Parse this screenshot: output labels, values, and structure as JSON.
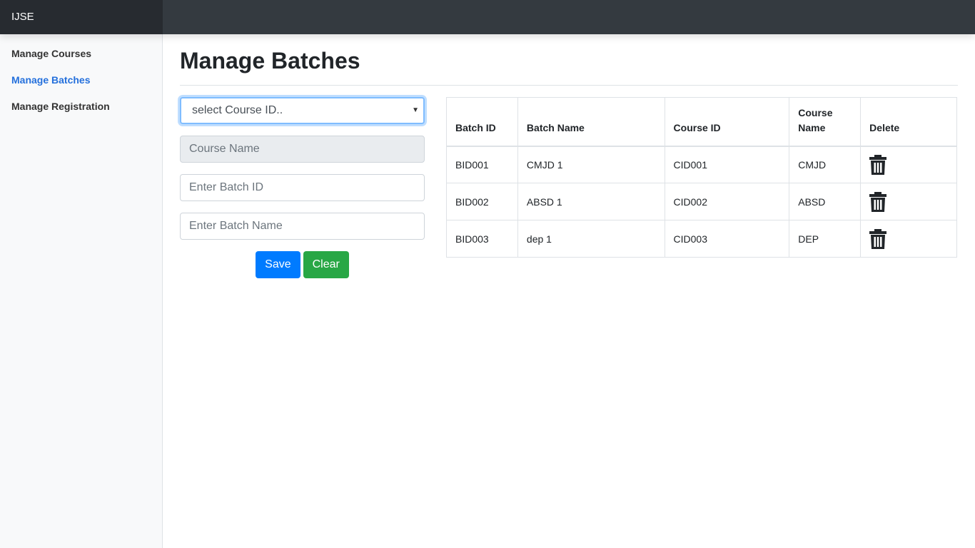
{
  "navbar": {
    "brand": "IJSE"
  },
  "sidebar": {
    "items": [
      {
        "label": "Manage Courses",
        "active": false
      },
      {
        "label": "Manage Batches",
        "active": true
      },
      {
        "label": "Manage Registration",
        "active": false
      }
    ]
  },
  "page": {
    "title": "Manage Batches"
  },
  "form": {
    "course_select": {
      "value": "select Course ID.."
    },
    "course_name": {
      "placeholder": "Course Name",
      "disabled": true
    },
    "batch_id": {
      "placeholder": "Enter Batch ID"
    },
    "batch_name": {
      "placeholder": "Enter Batch Name"
    },
    "save_label": "Save",
    "clear_label": "Clear"
  },
  "table": {
    "headers": [
      "Batch ID",
      "Batch Name",
      "Course ID",
      "Course Name",
      "Delete"
    ],
    "rows": [
      {
        "batch_id": "BID001",
        "batch_name": "CMJD 1",
        "course_id": "CID001",
        "course_name": "CMJD",
        "delete_icon": "trash-icon"
      },
      {
        "batch_id": "BID002",
        "batch_name": "ABSD 1",
        "course_id": "CID002",
        "course_name": "ABSD",
        "delete_icon": "trash-icon"
      },
      {
        "batch_id": "BID003",
        "batch_name": "dep 1",
        "course_id": "CID003",
        "course_name": "DEP",
        "delete_icon": "trash-icon"
      }
    ]
  },
  "colors": {
    "navbar": "#343a40",
    "brand_bg": "#272b30",
    "active_link": "#2470dc",
    "save_button": "#007bff",
    "clear_button": "#28a745"
  }
}
